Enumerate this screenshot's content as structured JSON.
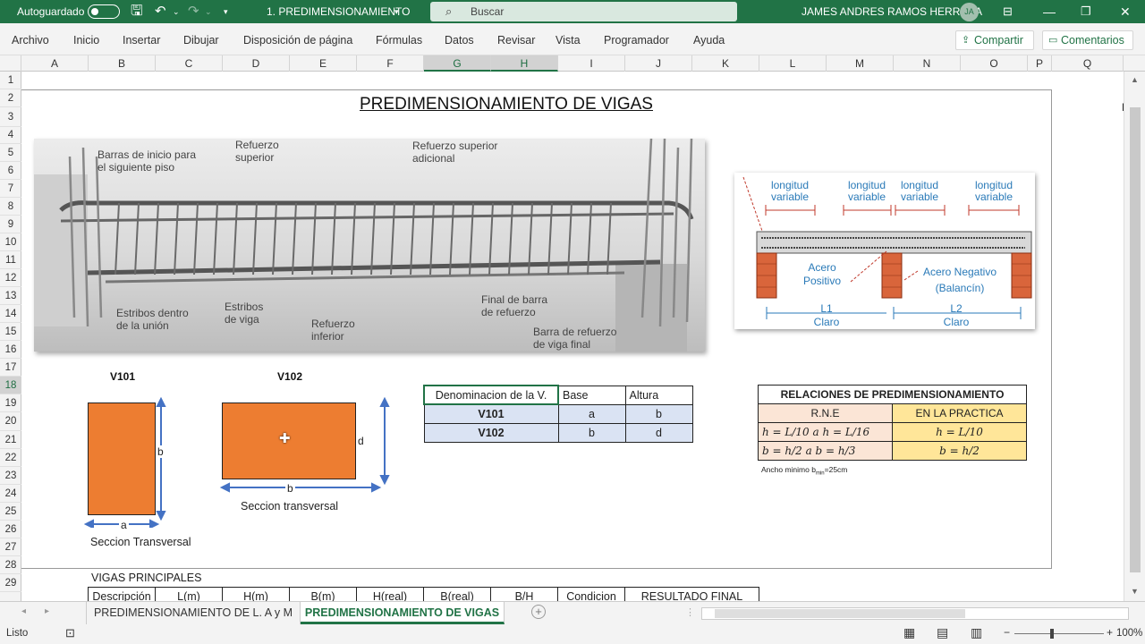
{
  "titlebar": {
    "autosave": "Autoguardado",
    "filename": "1. PREDIMENSIONAMIENTO",
    "search_placeholder": "Buscar",
    "user": "JAMES ANDRES RAMOS HERRERA",
    "initials": "JA"
  },
  "ribbon": {
    "tabs": [
      "Archivo",
      "Inicio",
      "Insertar",
      "Dibujar",
      "Disposición de página",
      "Fórmulas",
      "Datos",
      "Revisar",
      "Vista",
      "Programador",
      "Ayuda"
    ],
    "share": "Compartir",
    "comments": "Comentarios"
  },
  "columns": [
    "A",
    "B",
    "C",
    "D",
    "E",
    "F",
    "G",
    "H",
    "I",
    "J",
    "K",
    "L",
    "M",
    "N",
    "O",
    "P",
    "Q"
  ],
  "rows": [
    "1",
    "2",
    "3",
    "4",
    "5",
    "6",
    "7",
    "8",
    "9",
    "10",
    "11",
    "12",
    "13",
    "14",
    "15",
    "16",
    "17",
    "18",
    "19",
    "20",
    "21",
    "22",
    "23",
    "24",
    "25",
    "26",
    "27",
    "28",
    "29"
  ],
  "sheet": {
    "title": "PREDIMENSIONAMIENTO DE VIGAS",
    "photo_labels": [
      "Barras de inicio para",
      "el siguiente piso",
      "Refuerzo",
      "superior",
      "Refuerzo superior",
      "adicional",
      "Estribos dentro",
      "de la unión",
      "Estribos",
      "de viga",
      "Refuerzo",
      "inferior",
      "Final de barra",
      "de refuerzo",
      "Barra de refuerzo",
      "de viga final"
    ],
    "diagram_labels": [
      "longitud",
      "variable",
      "longitud",
      "variable",
      "longitud",
      "variable",
      "longitud",
      "variable",
      "Acero",
      "Positivo",
      "Acero Negativo",
      "(Balancín)",
      "L1",
      "Claro",
      "L2",
      "Claro"
    ],
    "v101": {
      "label": "V101",
      "dim_h": "b",
      "dim_w": "a",
      "caption": "Seccion Transversal"
    },
    "v102": {
      "label": "V102",
      "dim_h": "d",
      "dim_w": "b",
      "caption": "Seccion transversal"
    },
    "table1": {
      "headers": [
        "Denominacion de la V.",
        "Base",
        "Altura"
      ],
      "rows": [
        [
          "V101",
          "a",
          "b"
        ],
        [
          "V102",
          "b",
          "d"
        ]
      ]
    },
    "table2": {
      "title": "RELACIONES DE PREDIMENSIONAMIENTO",
      "col1": "R.N.E",
      "col2": "EN LA PRACTICA",
      "r1c1": "h = L/10   a  h = L/16",
      "r1c2": "h = L/10",
      "r2c1": "b = h/2    a  b = h/3",
      "r2c2": "b = h/2",
      "note": "Ancho minimo b",
      "note_sub": "min",
      "note_end": "=25cm"
    },
    "vigas_principales": "VIGAS PRINCIPALES",
    "table3_headers": [
      "Descripción",
      "L(m)",
      "H(m)",
      "B(m)",
      "H(real)",
      "B(real)",
      "B/H",
      "Condicion",
      "RESULTADO FINAL"
    ],
    "right_edge": "E"
  },
  "sheet_tabs": [
    "PREDIMENSIONAMIENTO DE L. A y M",
    "PREDIMENSIONAMIENTO DE VIGAS"
  ],
  "status": {
    "ready": "Listo",
    "zoom": "100%"
  },
  "colors": {
    "excel_green": "#217346",
    "rect_fill": "#ed7d31",
    "table_blue": "#dae3f3",
    "practice_yellow": "#ffe699"
  }
}
